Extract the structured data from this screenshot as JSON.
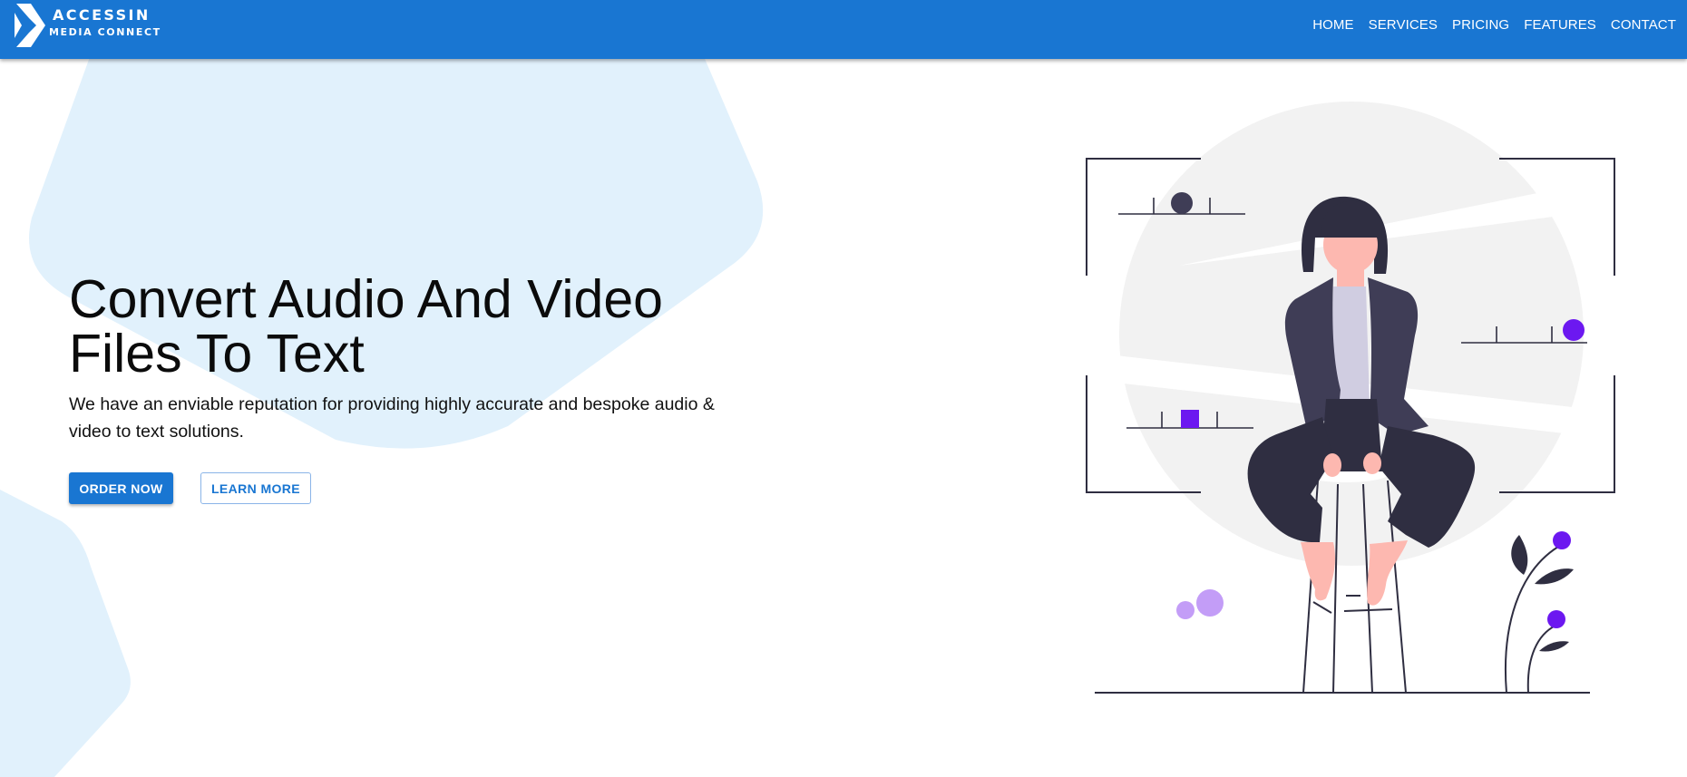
{
  "header": {
    "logo": {
      "line1": "ACCESSIN",
      "line2": "MEDIA CONNECT"
    },
    "nav": [
      {
        "label": "HOME"
      },
      {
        "label": "SERVICES"
      },
      {
        "label": "PRICING"
      },
      {
        "label": "FEATURES"
      },
      {
        "label": "CONTACT"
      }
    ]
  },
  "hero": {
    "title": "Convert Audio And Video Files To Text",
    "subtitle": "We have an enviable reputation for providing highly accurate and bespoke audio & video to text solutions.",
    "primary_button": "ORDER NOW",
    "secondary_button": "LEARN MORE"
  },
  "colors": {
    "brand": "#1976d2",
    "blob": "#e1f1fc",
    "accent_purple": "#6c18f0",
    "light_purple": "#c39df7",
    "figure_dark": "#2f2e41",
    "skin": "#fdb8b0",
    "backdrop_gray": "#f2f2f2"
  },
  "icons": {
    "logo_mark": "chevron-logo-icon",
    "illustration": "person-on-stool-illustration"
  }
}
